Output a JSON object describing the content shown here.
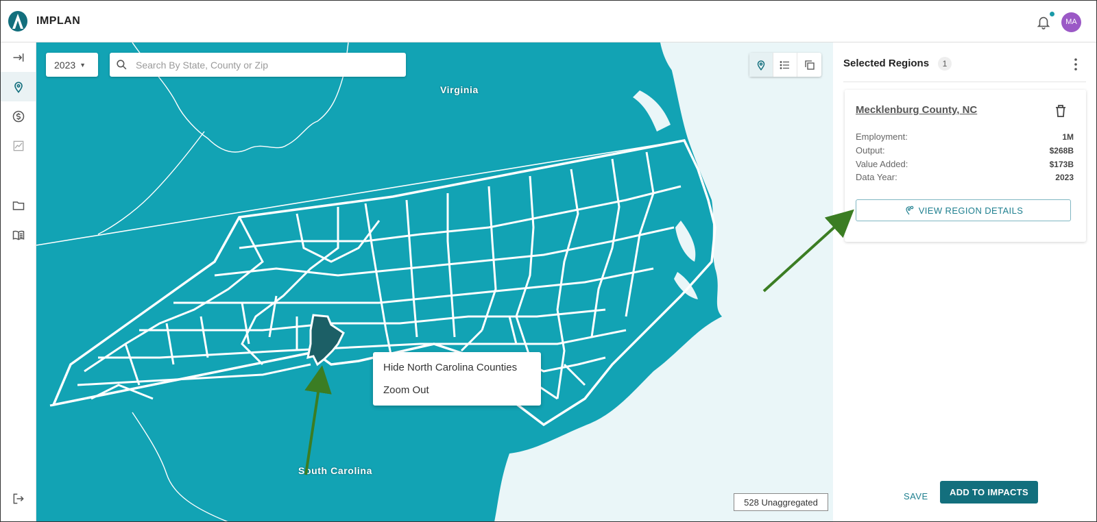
{
  "app": {
    "brand": "IMPLAN"
  },
  "header": {
    "avatar_initials": "MA",
    "notification_dot": true
  },
  "rail": {
    "items": [
      "collapse-expand",
      "map-pin",
      "dollar",
      "chart",
      "folder",
      "guide-book",
      "logout"
    ],
    "active": "map-pin"
  },
  "map": {
    "year": "2023",
    "search_placeholder": "Search By State, County or Zip",
    "labels": {
      "virginia": "Virginia",
      "south_carolina": "South Carolina"
    },
    "context_menu": {
      "hide_counties": "Hide North Carolina Counties",
      "zoom_out": "Zoom Out"
    },
    "unaggregated": "528 Unaggregated",
    "view_modes": [
      "map",
      "list",
      "copy"
    ],
    "active_view": "map"
  },
  "panel": {
    "title": "Selected Regions",
    "count": "1",
    "region": {
      "name": "Mecklenburg County, NC",
      "stats": [
        {
          "label": "Employment:",
          "value": "1M"
        },
        {
          "label": "Output:",
          "value": "$268B"
        },
        {
          "label": "Value Added:",
          "value": "$173B"
        },
        {
          "label": "Data Year:",
          "value": "2023"
        }
      ],
      "details_button": "VIEW REGION DETAILS"
    },
    "save": "SAVE",
    "add_to_impacts": "ADD TO IMPACTS"
  },
  "colors": {
    "map_fill": "#12a3b4",
    "selected_county": "#1c5f66",
    "water": "#eaf6f8",
    "accent": "#136f7d",
    "annotation_arrow": "#3b7d23"
  }
}
